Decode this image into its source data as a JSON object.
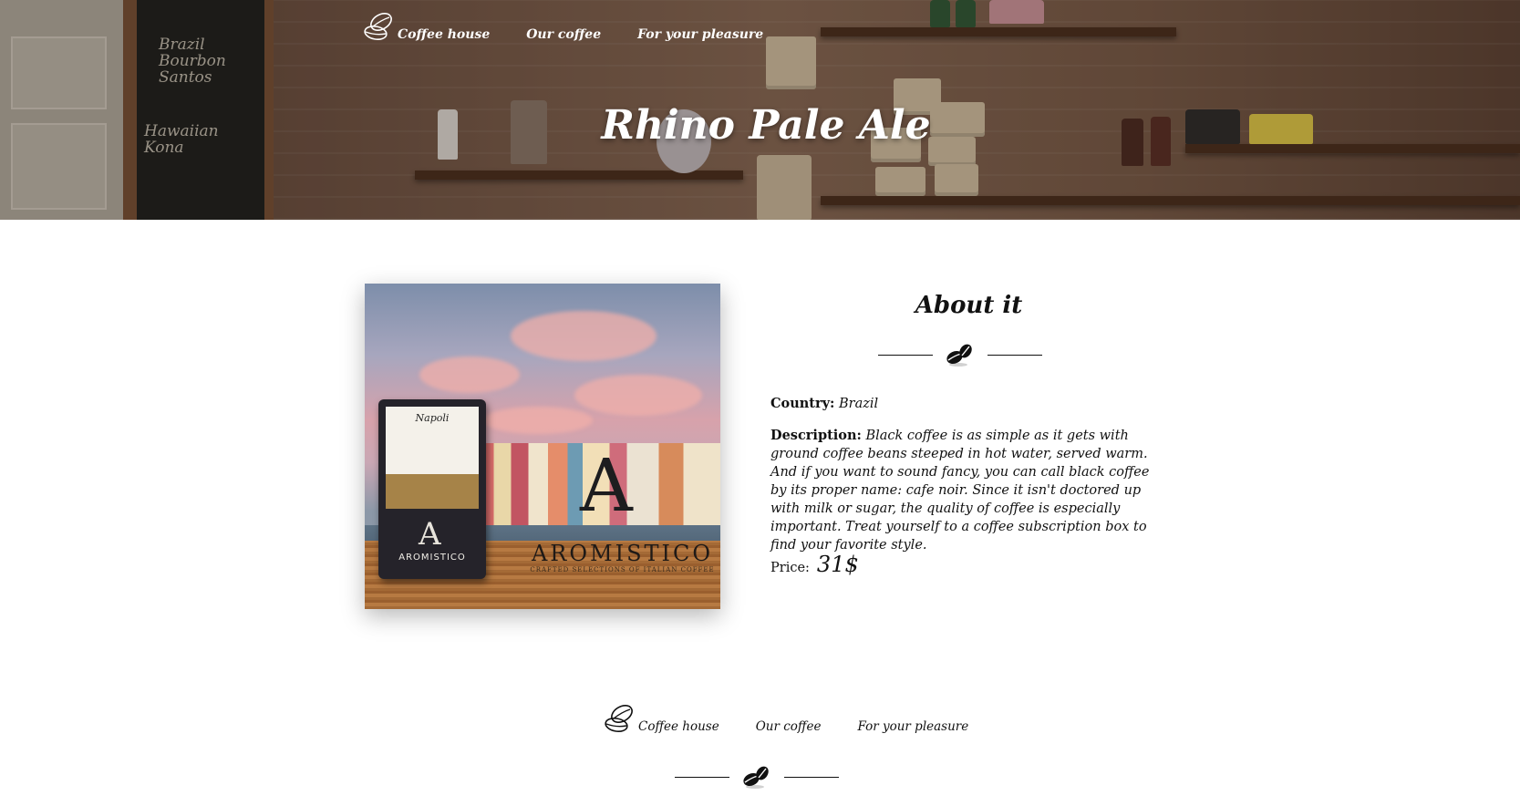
{
  "nav": {
    "logo_icon": "coffee-beans-outline-icon",
    "items": [
      {
        "label": "Coffee house"
      },
      {
        "label": "Our coffee"
      },
      {
        "label": "For your pleasure"
      }
    ]
  },
  "hero": {
    "title": "Rhino Pale Ale"
  },
  "product": {
    "image_alt_brand": "AROMISTICO",
    "image_tagline": "CRAFTED SELECTIONS OF ITALIAN COFFEE",
    "image_package_name": "Napoli",
    "about_title": "About it",
    "divider_icon": "coffee-beans-icon",
    "country_label": "Country:",
    "country_value": "Brazil",
    "description_label": "Description:",
    "description_value": "Black coffee is as simple as it gets with ground coffee beans steeped in hot water, served warm. And if you want to sound fancy, you can call black coffee by its proper name: cafe noir. Since it isn't doctored up with milk or sugar, the quality of coffee is especially important. Treat yourself to a coffee subscription box to find your favorite style.",
    "price_label": "Price:",
    "price_value": "31$"
  },
  "footer": {
    "logo_icon": "coffee-beans-outline-icon",
    "items": [
      {
        "label": "Coffee house"
      },
      {
        "label": "Our coffee"
      },
      {
        "label": "For your pleasure"
      }
    ],
    "divider_icon": "coffee-beans-icon"
  },
  "colors": {
    "text": "#111111",
    "hero_text": "#ffffff",
    "background": "#ffffff"
  }
}
